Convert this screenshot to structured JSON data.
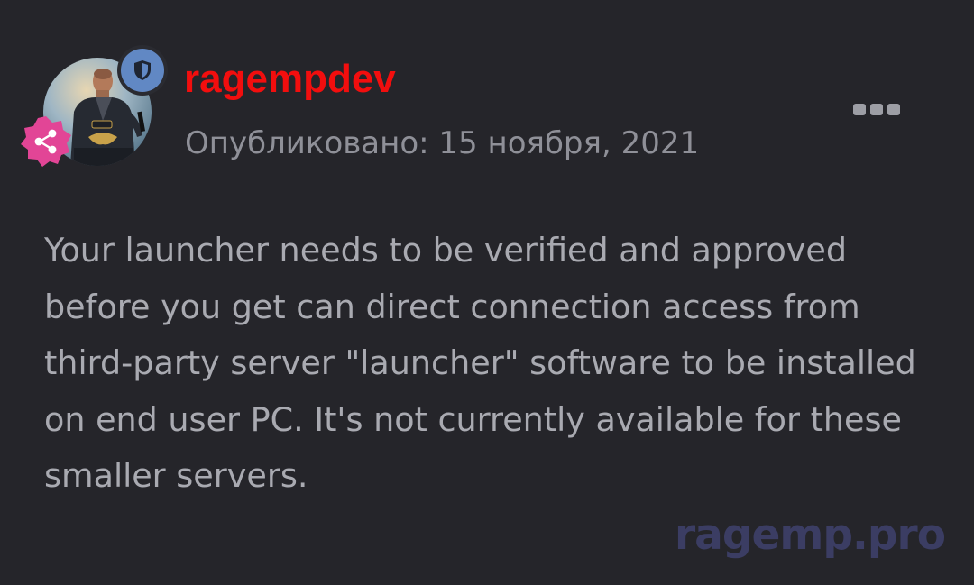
{
  "post": {
    "author": {
      "username": "ragempdev",
      "username_color": "#f20e0e"
    },
    "published_label": "Опубликовано: 15 ноября, 2021",
    "content_lines": [
      "Your launcher needs to be verified and approved",
      "before you get can direct connection access from",
      "third-party server \"launcher\" software to be installed",
      "on end user PC. It's not currently available for these",
      "smaller servers."
    ],
    "badges": {
      "role_badge_icon": "shield-icon",
      "role_badge_color": "#6188c4",
      "group_badge_icon": "share-icon",
      "group_badge_color": "#e24596"
    },
    "menu_icon": "more-icon"
  },
  "watermark": "ragemp.pro",
  "colors": {
    "background": "#25252a",
    "text": "#a9aab1",
    "muted": "#8f9098"
  }
}
